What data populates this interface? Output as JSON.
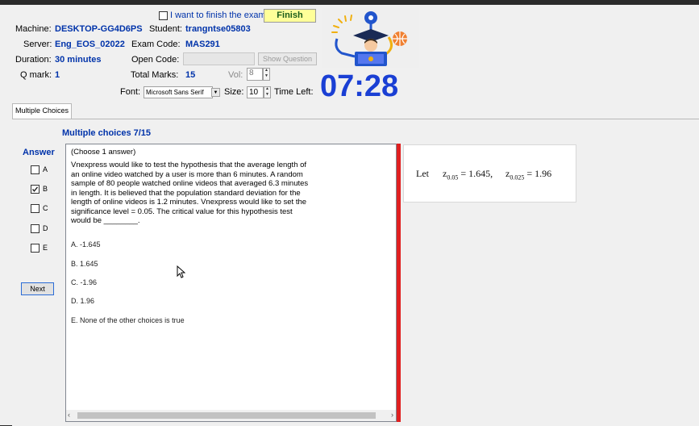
{
  "header": {
    "finish_checkbox_label": "I want to finish the exam.",
    "finish_button": "Finish",
    "machine_label": "Machine:",
    "machine_value": "DESKTOP-GG4D6PS",
    "student_label": "Student:",
    "student_value": "trangntse05803",
    "server_label": "Server:",
    "server_value": "Eng_EOS_02022",
    "exam_code_label": "Exam Code:",
    "exam_code_value": "MAS291",
    "duration_label": "Duration:",
    "duration_value": "30 minutes",
    "open_code_label": "Open Code:",
    "open_code_value": "",
    "show_question_button": "Show Question",
    "qmark_label": "Q mark:",
    "qmark_value": "1",
    "total_marks_label": "Total Marks:",
    "total_marks_value": "15",
    "vol_label": "Vol:",
    "vol_value": "8",
    "font_label": "Font:",
    "font_value": "Microsoft Sans Serif",
    "size_label": "Size:",
    "size_value": "10",
    "time_left_label": "Time Left:",
    "timer": "07:28"
  },
  "tabs": [
    {
      "label": "Multiple Choices"
    }
  ],
  "question": {
    "heading": "Multiple choices 7/15",
    "answer_label": "Answer",
    "answers": [
      {
        "label": "A",
        "checked": false
      },
      {
        "label": "B",
        "checked": true
      },
      {
        "label": "C",
        "checked": false
      },
      {
        "label": "D",
        "checked": false
      },
      {
        "label": "E",
        "checked": false
      }
    ],
    "next_button": "Next",
    "instruction": "(Choose 1 answer)",
    "text": "Vnexpress would like to test the hypothesis that the average length of an online video watched by a user is more than 6 minutes. A random sample of 80 people watched online videos that averaged 6.3 minutes in length. It is believed that the population standard deviation for the length of online videos is 1.2 minutes. Vnexpress would like to set the significance level  = 0.05. The critical value for this hypothesis test would be ________.",
    "options": [
      "A.  -1.645",
      "B.  1.645",
      "C.  -1.96",
      "D.  1.96",
      "E.  None of the other choices is true"
    ]
  },
  "hint": {
    "let": "Let",
    "z1_sub": "0.05",
    "z1_eq": "= 1.645,",
    "z2_sub": "0.025",
    "z2_eq": "= 1.96"
  },
  "colors": {
    "accent_blue": "#0033aa",
    "timer_blue": "#1a3fd4",
    "divider_red": "#e02020",
    "finish_yellow": "#ffff99"
  }
}
